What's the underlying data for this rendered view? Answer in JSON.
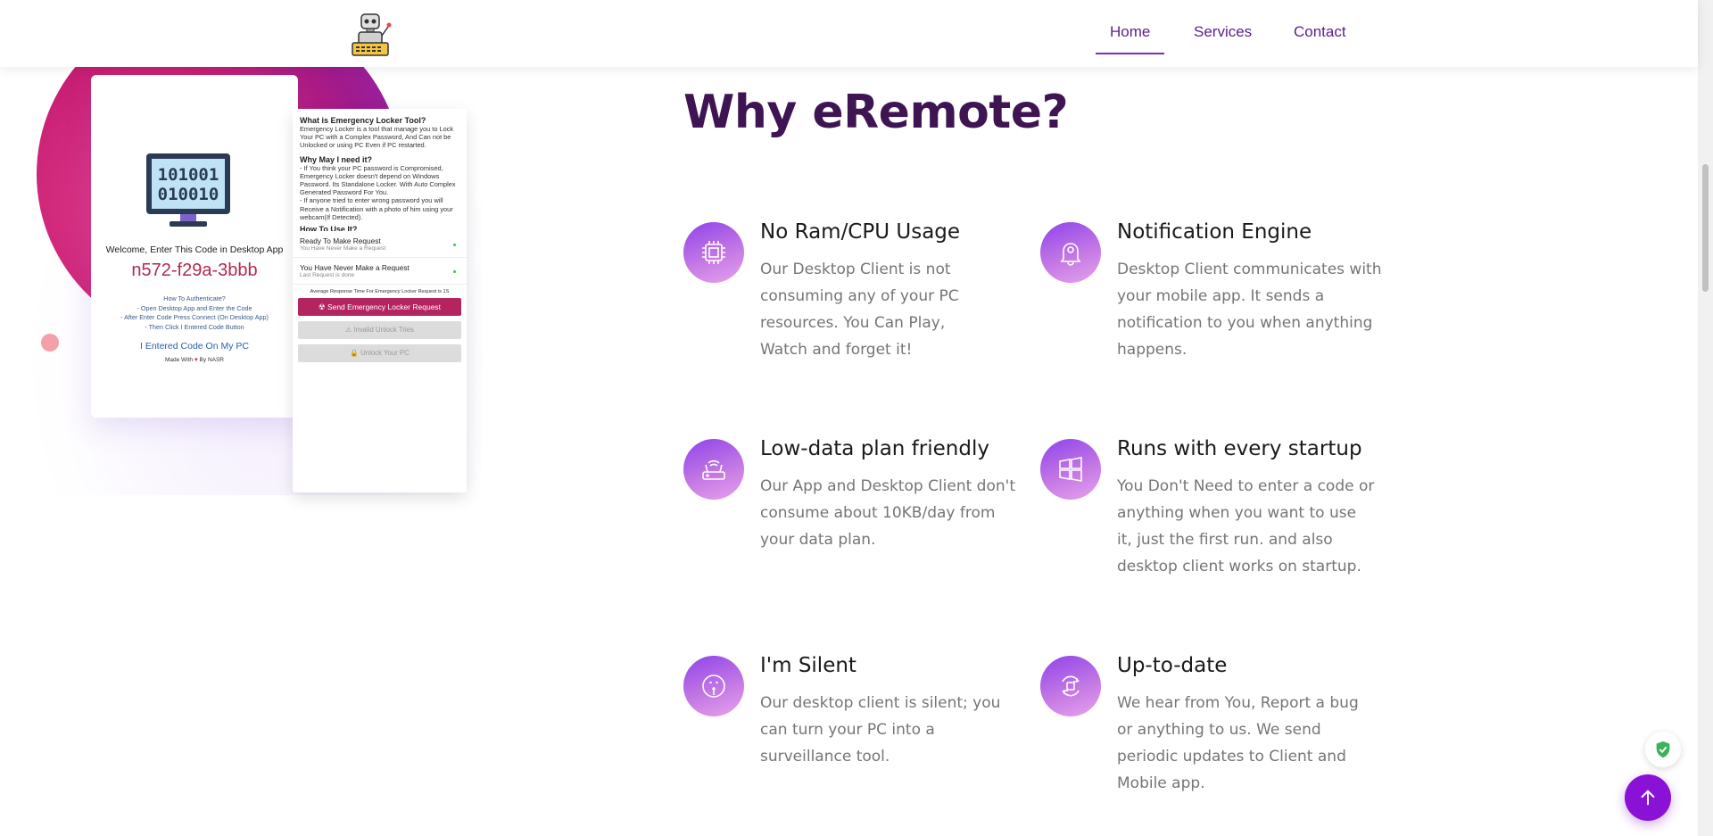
{
  "nav": {
    "logo_icon": "robot-logo-icon",
    "items": [
      {
        "label": "Home",
        "active": true
      },
      {
        "label": "Services",
        "active": false
      },
      {
        "label": "Contact",
        "active": false
      }
    ]
  },
  "hero_mock": {
    "left": {
      "monitor_text_1": "101001",
      "monitor_text_2": "010010",
      "welcome": "Welcome, Enter This Code in Desktop App",
      "code": "n572-f29a-3bbb",
      "howto_title": "How To Authenticate?",
      "howto_1": "- Open Desktop App and Enter the Code",
      "howto_2": "- After Enter Code Press Connect (On Desktop App)",
      "howto_3": "- Then Click I Entered Code Button",
      "entered_button": "I Entered Code On My PC",
      "made_with_prefix": "Made With",
      "made_with_suffix": "By NASR"
    },
    "right": {
      "q1": "What is Emergency Locker Tool?",
      "a1": "Emergency Locker is a tool that manage you to Lock Your PC with a Complex Password, And Can not be Unlocked or using PC Even if PC restarted.",
      "q2": "Why May I need it?",
      "a2": "- If You think your PC password is Compromised, Emergency Locker doesn't depend on Windows Password. Its Standalone Locker. With Auto Complex Generated Password For You.",
      "a3": "- If anyone tried to enter wrong password you will Receive a Notification with a photo of him using your webcam(If Detected).",
      "q3": "How To Use It?",
      "row1_title": "Ready To Make Request",
      "row1_sub": "You Have Never Make a Request",
      "row2_title": "You Have Never Make a Request",
      "row2_sub": "Last Request is done",
      "avg": "Average Response Time For Emergency Locker Request is 1S",
      "send_button": "Send Emergency Locker Request",
      "invalid_button": "Invalid Unlock Tries",
      "unlock_button": "Unlock Your PC"
    }
  },
  "section": {
    "title": "Why eRemote?",
    "features": [
      {
        "icon": "cpu-icon",
        "title": "No Ram/CPU Usage",
        "text": "Our Desktop Client is not consuming any of your PC resources. You Can Play, Watch and forget it!"
      },
      {
        "icon": "bell-icon",
        "title": "Notification Engine",
        "text": "Desktop Client communicates with your mobile app. It sends a notification to you when anything happens."
      },
      {
        "icon": "router-icon",
        "title": "Low-data plan friendly",
        "text": "Our App and Desktop Client don't consume about 10KB/day from your data plan."
      },
      {
        "icon": "windows-icon",
        "title": "Runs with every startup",
        "text": "You Don't Need to enter a code or anything when you want to use it, just the first run. and also desktop client works on startup."
      },
      {
        "icon": "silent-face-icon",
        "title": "I'm Silent",
        "text": "Our desktop client is silent; you can turn your PC into a surveillance tool."
      },
      {
        "icon": "update-icon",
        "title": "Up-to-date",
        "text": "We hear from You, Report a bug or anything to us. We send periodic updates to Client and Mobile app."
      }
    ]
  },
  "colors": {
    "brand": "#3e1452",
    "accent": "#8a11d6",
    "nav_text": "#5a1e8c"
  }
}
